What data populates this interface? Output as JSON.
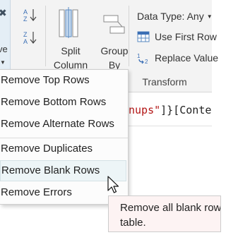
{
  "ribbon": {
    "remove_label": "ve",
    "split_column": {
      "line1": "Split",
      "line2": "Column"
    },
    "group_by": {
      "line1": "Group",
      "line2": "By"
    },
    "data_type": "Data Type: Any",
    "use_first_row": "Use First Row",
    "replace_values": "Replace Value",
    "transform_group": "Transform"
  },
  "formula": {
    "string_part": "nups\"",
    "rest": "]}[Conten"
  },
  "menu": {
    "items": [
      {
        "label": "Remove Top Rows"
      },
      {
        "label": "Remove Bottom Rows"
      },
      {
        "label": "Remove Alternate Rows"
      },
      {
        "label": "Remove Duplicates"
      },
      {
        "label": "Remove Blank Rows",
        "hovered": true
      },
      {
        "label": "Remove Errors"
      }
    ]
  },
  "tooltip": {
    "line1": "Remove all blank row",
    "line2": "table."
  }
}
